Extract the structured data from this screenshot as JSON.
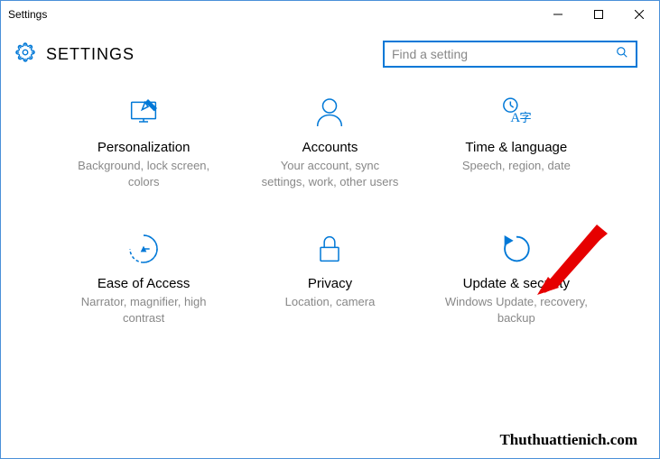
{
  "window": {
    "title": "Settings"
  },
  "header": {
    "title": "SETTINGS"
  },
  "search": {
    "placeholder": "Find a setting"
  },
  "tiles": [
    {
      "title": "Personalization",
      "desc": "Background, lock screen, colors"
    },
    {
      "title": "Accounts",
      "desc": "Your account, sync settings, work, other users"
    },
    {
      "title": "Time & language",
      "desc": "Speech, region, date"
    },
    {
      "title": "Ease of Access",
      "desc": "Narrator, magnifier, high contrast"
    },
    {
      "title": "Privacy",
      "desc": "Location, camera"
    },
    {
      "title": "Update & security",
      "desc": "Windows Update, recovery, backup"
    }
  ],
  "watermark": "Thuthuattienich.com",
  "colors": {
    "accent": "#0078d7",
    "tile_icon": "#0078d7",
    "muted": "#888888"
  }
}
